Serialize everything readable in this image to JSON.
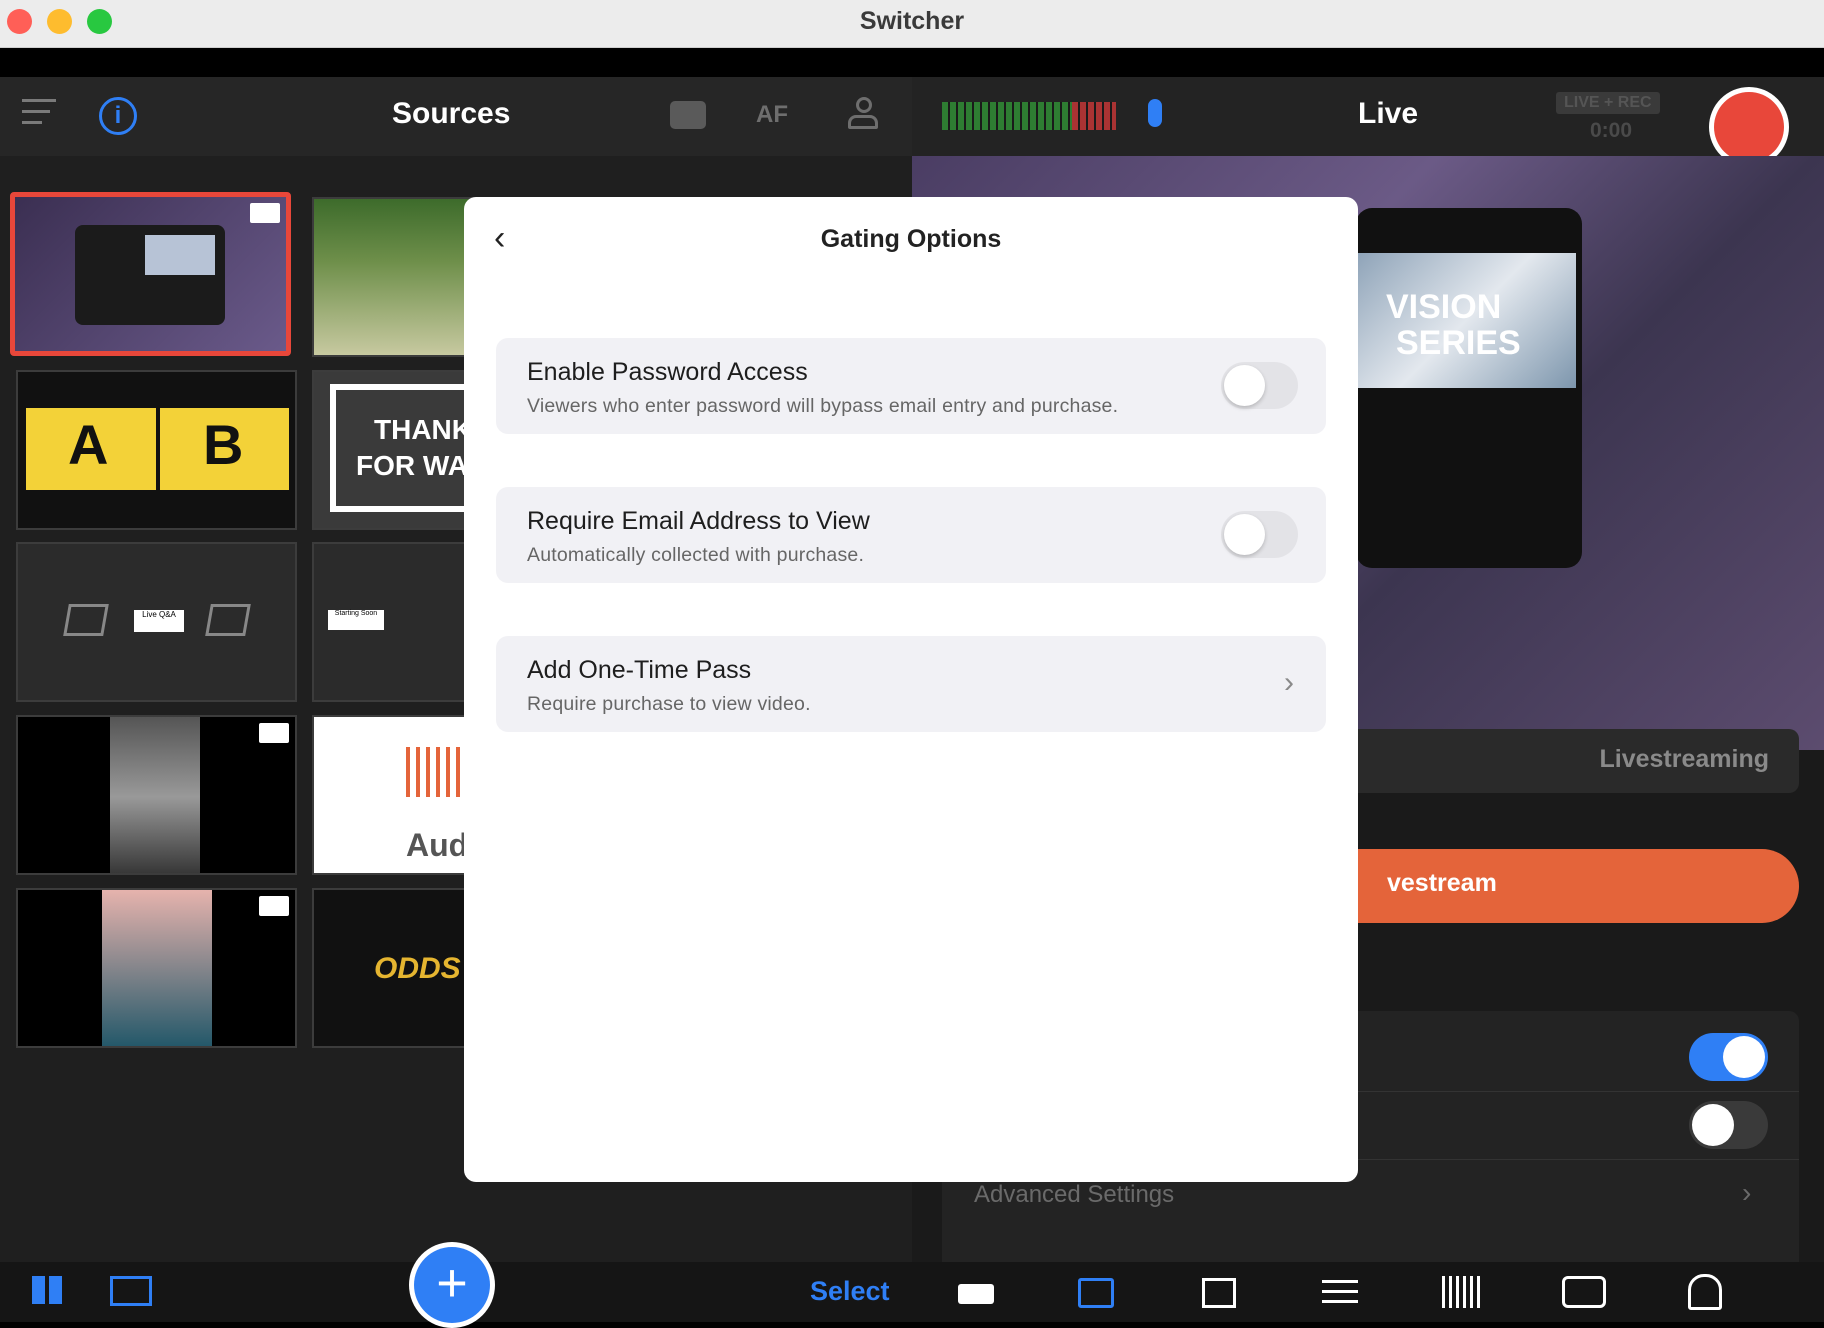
{
  "window": {
    "title": "Switcher"
  },
  "sources_panel": {
    "title": "Sources",
    "af_label": "AF",
    "select_label": "Select",
    "thumbnails": [
      {
        "text": ""
      },
      {
        "text": ""
      },
      {
        "text_a": "A",
        "text_b": "B"
      },
      {
        "line1": "THANK",
        "line2": "FOR WAT"
      },
      {
        "text": "Live Q&A"
      },
      {
        "text": "Starting Soon"
      },
      {
        "text": ""
      },
      {
        "text": "Aud"
      },
      {
        "text": ""
      },
      {
        "text": "ODDS"
      }
    ]
  },
  "live_panel": {
    "title": "Live",
    "badge": "LIVE + REC",
    "timer": "0:00",
    "mode_select": "Livestreaming",
    "stream_button": "vestream",
    "advanced": "Advanced Settings",
    "preview_text_1": "VISION",
    "preview_text_2": "SERIES"
  },
  "modal": {
    "title": "Gating Options",
    "items": [
      {
        "title": "Enable Password Access",
        "subtitle": "Viewers who enter password will bypass email entry and purchase.",
        "toggle": false
      },
      {
        "title": "Require Email Address to View",
        "subtitle": "Automatically collected with purchase.",
        "toggle": false
      },
      {
        "title": "Add One-Time Pass",
        "subtitle": "Require purchase to view video."
      }
    ]
  },
  "colors": {
    "accent_blue": "#2f7ff5",
    "record_red": "#e8473a",
    "stream_orange": "#e4643a"
  }
}
